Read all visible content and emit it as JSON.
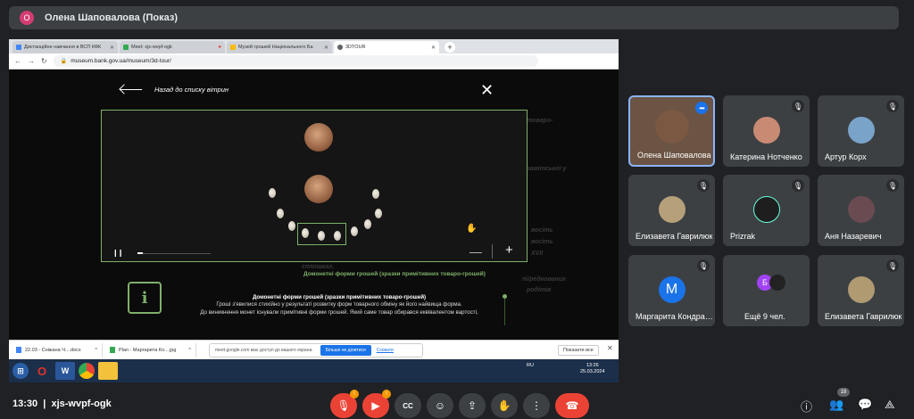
{
  "presenter": {
    "initial": "О",
    "title": "Олена Шаповалова (Показ)"
  },
  "browser": {
    "tabs": [
      {
        "label": "Дистанційне навчання в ВСП КФК",
        "color": "#4285f4"
      },
      {
        "label": "Meet: xjs-wvpf-ogk",
        "color": "#34a853"
      },
      {
        "label": "Музей грошей Національного Ба",
        "color": "#fbbc04"
      },
      {
        "label": "3DTOUR",
        "color": "#5f6368"
      }
    ],
    "url": "museum.bank.gov.ua/museum/3d-tour/"
  },
  "tour": {
    "back_label": "Назад до списку вітрин",
    "close": "✕",
    "ghost_lines": [
      "ші товаро-",
      "замітської у",
      "восіть",
      "восіть",
      "XVII",
      "сплошках.",
      "пі/редкованих",
      "родітів"
    ],
    "caption_title": "Домонетні форми грошей (зразки примітивних товаро-грошей)",
    "info_symbol": "i",
    "desc_title": "Домонетні форми грошей (зразки примітивних товаро-грошей)",
    "desc_lines": [
      "Гроші з'явилися стихійно у результаті розвитку форм товарного обміну як його найвища форма.",
      "До виникнення монет існували примітивні форми грошей. Який саме товар обирався еквівалентом вартості,"
    ],
    "progress": 0.07,
    "zoom_minus": "—",
    "zoom_plus": "+"
  },
  "downloads": {
    "items": [
      {
        "label": "22.03 - Сніжана Ч....docx"
      },
      {
        "label": "Plan - Маргарита Ко....jpg"
      }
    ],
    "meet_notice": "meet.google.com має доступ до вашого екрана.",
    "stop_label": "Більше не ділитися",
    "hide_label": "Сховати",
    "show_all": "Показати все"
  },
  "taskbar": {
    "lang": "RU",
    "time": "13:26",
    "date": "25.03.2024"
  },
  "participants": [
    {
      "name": "Олена Шаповалова",
      "speaker": true
    },
    {
      "name": "Катерина Нотченко",
      "avatar_color": "#c98a73"
    },
    {
      "name": "Артур Корх",
      "avatar_color": "#7aa3c9"
    },
    {
      "name": "Елизавета Гаврилюк",
      "avatar_color": "#b5a07a"
    },
    {
      "name": "Prizrak",
      "avatar_color": "#1e1e1e"
    },
    {
      "name": "Аня Назаревич",
      "avatar_color": "#6a4b52"
    },
    {
      "name": "Маргарита Кондрашова",
      "initial": "М",
      "avatar_color": "#1a73e8"
    },
    {
      "name": "Ещё 9 чел.",
      "initial": "Б",
      "avatar_color": "#a142f4"
    },
    {
      "name": "Елизавета Гаврилюк",
      "avatar_color": "#b09a72"
    }
  ],
  "bottom": {
    "time": "13:30",
    "meeting_code": "xjs-wvpf-ogk",
    "mic_badge": "!",
    "cam_badge": "!",
    "participants_count": "18"
  }
}
